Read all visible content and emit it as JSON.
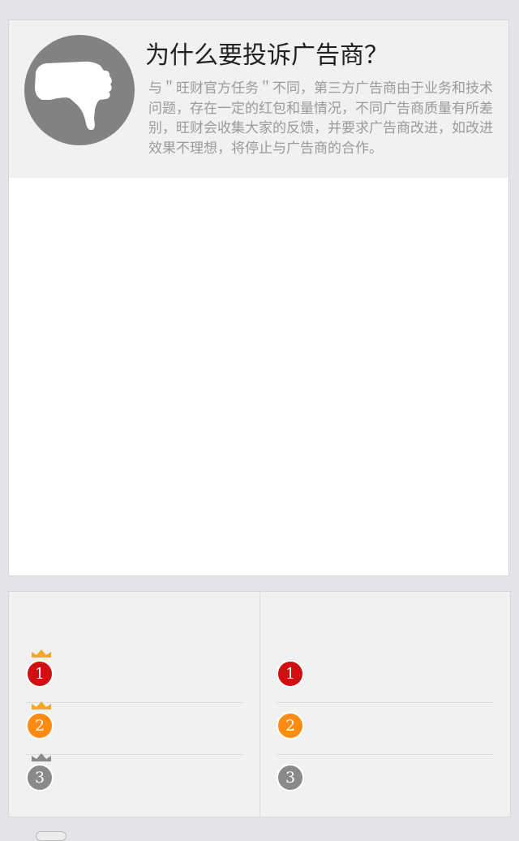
{
  "header": {
    "title": "为什么要投诉广告商？",
    "description": "与＂旺财官方任务＂不同，第三方广告商由于业务和技术问题，存在一定的红包和量情况，不同广告商质量有所差别，旺财会收集大家的反馈，并要求广告商改进，如改进效果不理想，将停止与广告商的合作。",
    "icon": "thumbs-down-icon"
  },
  "rankings": {
    "left": [
      {
        "rank": "1",
        "color": "#d10f10",
        "crown": "crown-gold-icon"
      },
      {
        "rank": "2",
        "color": "#ff8b11",
        "crown": "crown-gold-icon"
      },
      {
        "rank": "3",
        "color": "#8a8a8a",
        "crown": "crown-gray-icon"
      }
    ],
    "right": [
      {
        "rank": "1",
        "color": "#d10f10"
      },
      {
        "rank": "2",
        "color": "#ff8b11"
      },
      {
        "rank": "3",
        "color": "#8a8a8a"
      }
    ]
  },
  "colors": {
    "background": "#e5e4e9",
    "header_bg": "#f1f1f1",
    "crown_gold": "#f5a623",
    "crown_gray": "#8a8a8a"
  }
}
